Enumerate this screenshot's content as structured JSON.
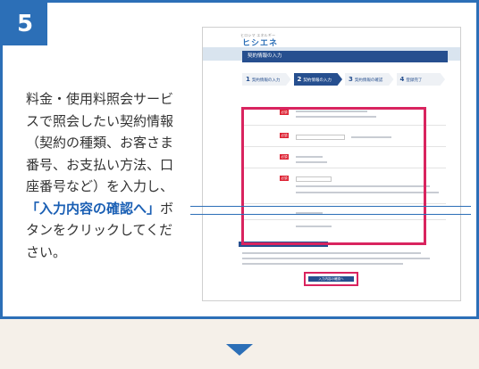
{
  "step": {
    "number": "5"
  },
  "description": {
    "line1": "料金・使用料照会サービスで照会したい契約情報（契約の種類、お客さま番号、お支払い方法、口座番号など）を入力し、",
    "highlight": "「入力内容の確認へ」",
    "line2": "ボタンをクリックしてください。"
  },
  "screenshot": {
    "logo_sub": "ヒロシマ エネルギー",
    "logo": "ヒシエネ",
    "page_title": "契約情報の入力",
    "steps": [
      {
        "num": "1",
        "label": "契約情報の入力"
      },
      {
        "num": "2",
        "label": "契約情報の入力"
      },
      {
        "num": "3",
        "label": "契約情報の確認"
      },
      {
        "num": "4",
        "label": "登録完了"
      }
    ],
    "required_badge": "必須",
    "submit_label": "入力内容の確認へ"
  },
  "colors": {
    "accent": "#2c6fb7",
    "highlight_frame": "#d9245f",
    "background": "#f5f0e9"
  }
}
